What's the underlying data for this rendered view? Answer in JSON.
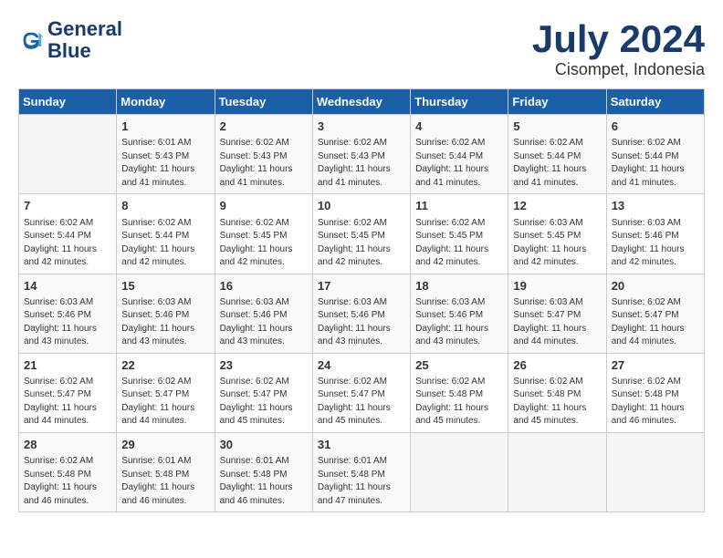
{
  "logo": {
    "line1": "General",
    "line2": "Blue"
  },
  "title": "July 2024",
  "location": "Cisompet, Indonesia",
  "days_of_week": [
    "Sunday",
    "Monday",
    "Tuesday",
    "Wednesday",
    "Thursday",
    "Friday",
    "Saturday"
  ],
  "weeks": [
    [
      {
        "day": "",
        "detail": ""
      },
      {
        "day": "1",
        "detail": "Sunrise: 6:01 AM\nSunset: 5:43 PM\nDaylight: 11 hours\nand 41 minutes."
      },
      {
        "day": "2",
        "detail": "Sunrise: 6:02 AM\nSunset: 5:43 PM\nDaylight: 11 hours\nand 41 minutes."
      },
      {
        "day": "3",
        "detail": "Sunrise: 6:02 AM\nSunset: 5:43 PM\nDaylight: 11 hours\nand 41 minutes."
      },
      {
        "day": "4",
        "detail": "Sunrise: 6:02 AM\nSunset: 5:44 PM\nDaylight: 11 hours\nand 41 minutes."
      },
      {
        "day": "5",
        "detail": "Sunrise: 6:02 AM\nSunset: 5:44 PM\nDaylight: 11 hours\nand 41 minutes."
      },
      {
        "day": "6",
        "detail": "Sunrise: 6:02 AM\nSunset: 5:44 PM\nDaylight: 11 hours\nand 41 minutes."
      }
    ],
    [
      {
        "day": "7",
        "detail": "Sunrise: 6:02 AM\nSunset: 5:44 PM\nDaylight: 11 hours\nand 42 minutes."
      },
      {
        "day": "8",
        "detail": "Sunrise: 6:02 AM\nSunset: 5:44 PM\nDaylight: 11 hours\nand 42 minutes."
      },
      {
        "day": "9",
        "detail": "Sunrise: 6:02 AM\nSunset: 5:45 PM\nDaylight: 11 hours\nand 42 minutes."
      },
      {
        "day": "10",
        "detail": "Sunrise: 6:02 AM\nSunset: 5:45 PM\nDaylight: 11 hours\nand 42 minutes."
      },
      {
        "day": "11",
        "detail": "Sunrise: 6:02 AM\nSunset: 5:45 PM\nDaylight: 11 hours\nand 42 minutes."
      },
      {
        "day": "12",
        "detail": "Sunrise: 6:03 AM\nSunset: 5:45 PM\nDaylight: 11 hours\nand 42 minutes."
      },
      {
        "day": "13",
        "detail": "Sunrise: 6:03 AM\nSunset: 5:46 PM\nDaylight: 11 hours\nand 42 minutes."
      }
    ],
    [
      {
        "day": "14",
        "detail": "Sunrise: 6:03 AM\nSunset: 5:46 PM\nDaylight: 11 hours\nand 43 minutes."
      },
      {
        "day": "15",
        "detail": "Sunrise: 6:03 AM\nSunset: 5:46 PM\nDaylight: 11 hours\nand 43 minutes."
      },
      {
        "day": "16",
        "detail": "Sunrise: 6:03 AM\nSunset: 5:46 PM\nDaylight: 11 hours\nand 43 minutes."
      },
      {
        "day": "17",
        "detail": "Sunrise: 6:03 AM\nSunset: 5:46 PM\nDaylight: 11 hours\nand 43 minutes."
      },
      {
        "day": "18",
        "detail": "Sunrise: 6:03 AM\nSunset: 5:46 PM\nDaylight: 11 hours\nand 43 minutes."
      },
      {
        "day": "19",
        "detail": "Sunrise: 6:03 AM\nSunset: 5:47 PM\nDaylight: 11 hours\nand 44 minutes."
      },
      {
        "day": "20",
        "detail": "Sunrise: 6:02 AM\nSunset: 5:47 PM\nDaylight: 11 hours\nand 44 minutes."
      }
    ],
    [
      {
        "day": "21",
        "detail": "Sunrise: 6:02 AM\nSunset: 5:47 PM\nDaylight: 11 hours\nand 44 minutes."
      },
      {
        "day": "22",
        "detail": "Sunrise: 6:02 AM\nSunset: 5:47 PM\nDaylight: 11 hours\nand 44 minutes."
      },
      {
        "day": "23",
        "detail": "Sunrise: 6:02 AM\nSunset: 5:47 PM\nDaylight: 11 hours\nand 45 minutes."
      },
      {
        "day": "24",
        "detail": "Sunrise: 6:02 AM\nSunset: 5:47 PM\nDaylight: 11 hours\nand 45 minutes."
      },
      {
        "day": "25",
        "detail": "Sunrise: 6:02 AM\nSunset: 5:48 PM\nDaylight: 11 hours\nand 45 minutes."
      },
      {
        "day": "26",
        "detail": "Sunrise: 6:02 AM\nSunset: 5:48 PM\nDaylight: 11 hours\nand 45 minutes."
      },
      {
        "day": "27",
        "detail": "Sunrise: 6:02 AM\nSunset: 5:48 PM\nDaylight: 11 hours\nand 46 minutes."
      }
    ],
    [
      {
        "day": "28",
        "detail": "Sunrise: 6:02 AM\nSunset: 5:48 PM\nDaylight: 11 hours\nand 46 minutes."
      },
      {
        "day": "29",
        "detail": "Sunrise: 6:01 AM\nSunset: 5:48 PM\nDaylight: 11 hours\nand 46 minutes."
      },
      {
        "day": "30",
        "detail": "Sunrise: 6:01 AM\nSunset: 5:48 PM\nDaylight: 11 hours\nand 46 minutes."
      },
      {
        "day": "31",
        "detail": "Sunrise: 6:01 AM\nSunset: 5:48 PM\nDaylight: 11 hours\nand 47 minutes."
      },
      {
        "day": "",
        "detail": ""
      },
      {
        "day": "",
        "detail": ""
      },
      {
        "day": "",
        "detail": ""
      }
    ]
  ]
}
